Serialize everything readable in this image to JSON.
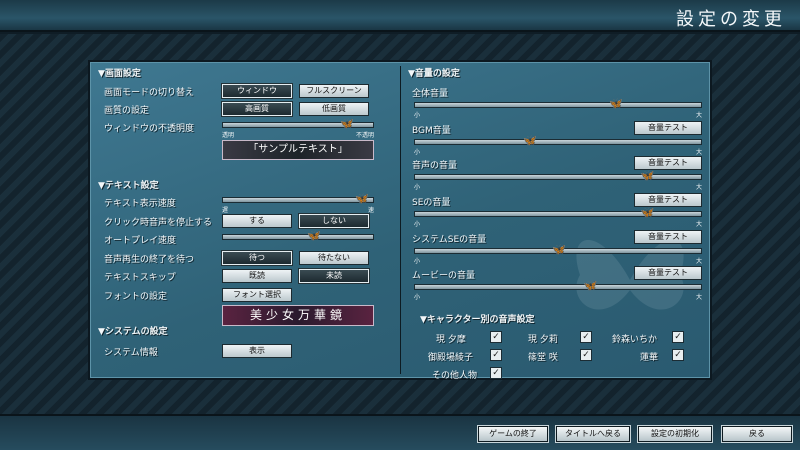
{
  "window": {
    "title": "設定の変更"
  },
  "left": {
    "screen": {
      "heading": "▼画面設定",
      "mode_label": "画面モードの切り替え",
      "mode_window": "ウィンドウ",
      "mode_full": "フルスクリーン",
      "quality_label": "画質の設定",
      "quality_high": "高画質",
      "quality_low": "低画質",
      "opacity_label": "ウィンドウの不透明度",
      "opacity_min": "透明",
      "opacity_max": "不透明",
      "opacity_value": 0.82,
      "sample_text": "「サンプルテキスト」"
    },
    "text": {
      "heading": "▼テキスト設定",
      "speed_label": "テキスト表示速度",
      "speed_min": "遅",
      "speed_max": "速",
      "speed_value": 0.92,
      "click_stop_label": "クリック時音声を停止する",
      "click_stop_yes": "する",
      "click_stop_no": "しない",
      "auto_label": "オートプレイ速度",
      "auto_value": 0.6,
      "wait_voice_label": "音声再生の終了を待つ",
      "wait_yes": "待つ",
      "wait_no": "待たない",
      "skip_label": "テキストスキップ",
      "skip_read": "既読",
      "skip_unread": "未読",
      "font_label": "フォントの設定",
      "font_button": "フォント選択",
      "font_sample": "美少女万華鏡"
    },
    "system": {
      "heading": "▼システムの設定",
      "info_label": "システム情報",
      "info_button": "表示"
    }
  },
  "right": {
    "heading": "▼音量の設定",
    "min": "小",
    "max": "大",
    "test_button": "音量テスト",
    "volumes": [
      {
        "label": "全体音量",
        "value": 0.7
      },
      {
        "label": "BGM音量",
        "value": 0.4
      },
      {
        "label": "音声の音量",
        "value": 0.81
      },
      {
        "label": "SEの音量",
        "value": 0.81
      },
      {
        "label": "システムSEの音量",
        "value": 0.5
      },
      {
        "label": "ムービーの音量",
        "value": 0.61
      }
    ],
    "characters": {
      "heading": "▼キャラクター別の音声設定",
      "check": "✓",
      "names": [
        "現 夕摩",
        "現 夕莉",
        "鈴森いちか",
        "御殿場綾子",
        "篠堂 咲",
        "蓮華",
        "その他人物"
      ]
    }
  },
  "bottom": {
    "end_game": "ゲームの終了",
    "to_title": "タイトルへ戻る",
    "reset": "設定の初期化",
    "back": "戻る"
  }
}
